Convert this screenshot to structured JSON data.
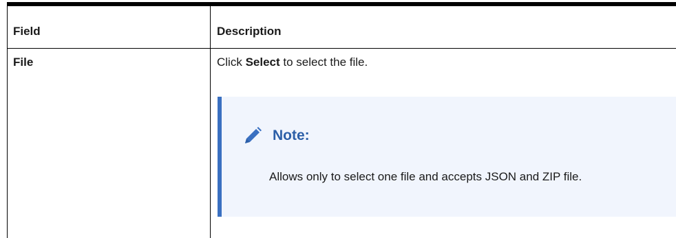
{
  "table": {
    "headers": {
      "field": "Field",
      "description": "Description"
    },
    "row": {
      "field": "File",
      "desc_before": "Click ",
      "desc_bold": "Select",
      "desc_after": " to select the file."
    }
  },
  "note": {
    "icon": "pencil-icon",
    "title": "Note:",
    "body": "Allows only to select one file and accepts JSON and ZIP file."
  },
  "colors": {
    "note_accent": "#3a70c1",
    "note_bg": "#f1f5fd",
    "note_title": "#2c5fa8"
  }
}
